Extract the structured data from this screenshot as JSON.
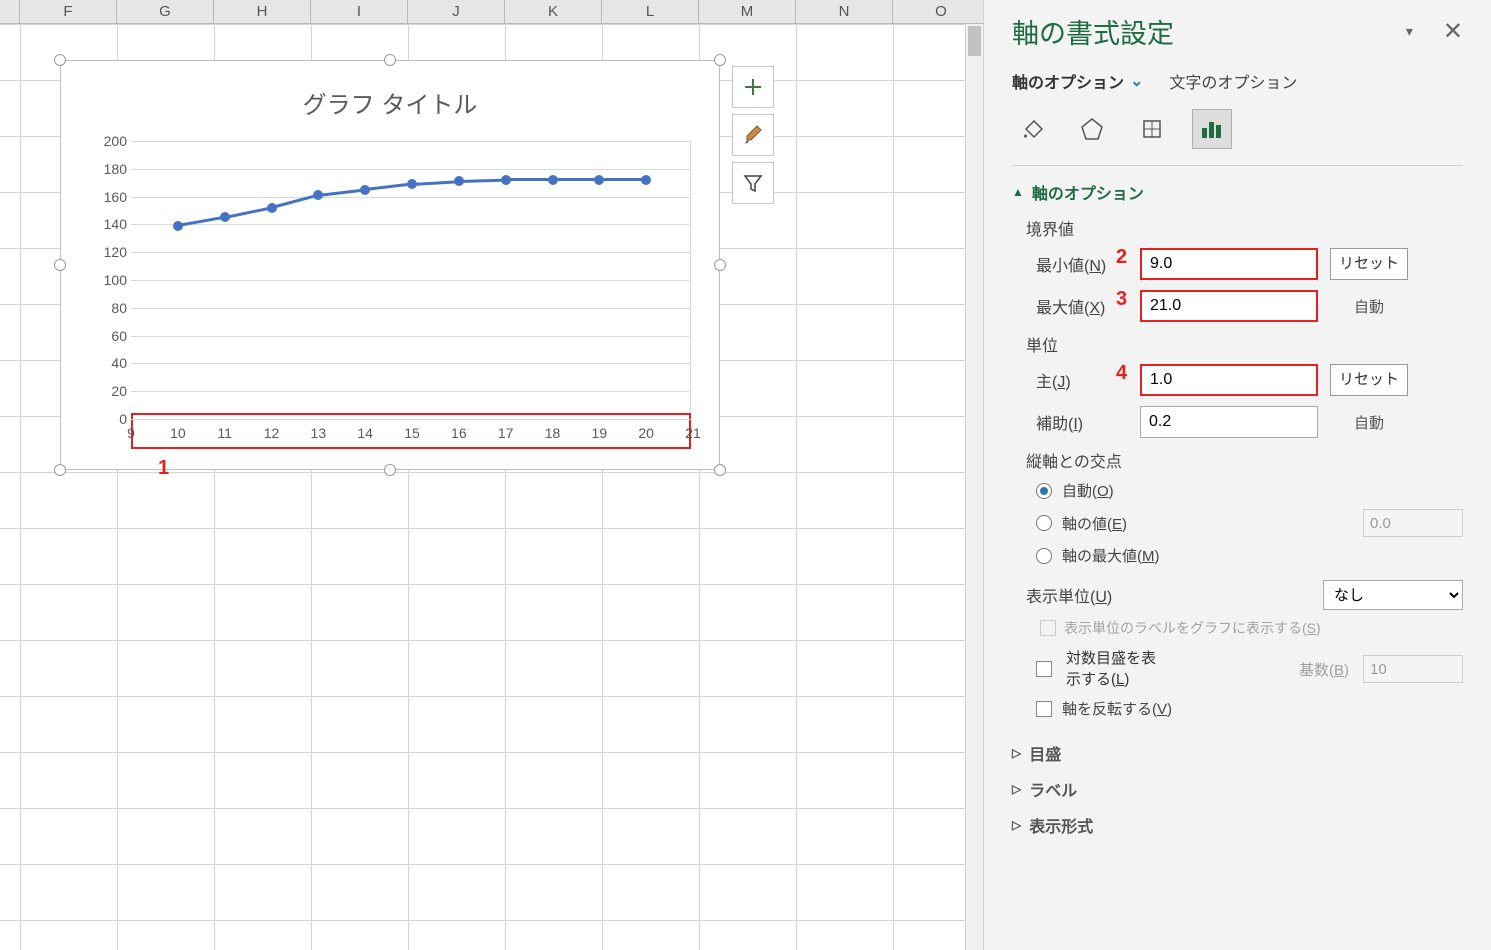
{
  "columns": [
    "F",
    "G",
    "H",
    "I",
    "J",
    "K",
    "L",
    "M",
    "N",
    "O"
  ],
  "chart": {
    "title": "グラフ タイトル",
    "y_ticks": [
      "200",
      "180",
      "160",
      "140",
      "120",
      "100",
      "80",
      "60",
      "40",
      "20",
      "0"
    ],
    "x_ticks": [
      "9",
      "10",
      "11",
      "12",
      "13",
      "14",
      "15",
      "16",
      "17",
      "18",
      "19",
      "20",
      "21"
    ]
  },
  "chart_data": {
    "type": "line",
    "title": "グラフ タイトル",
    "xlabel": "",
    "ylabel": "",
    "xlim": [
      9,
      21
    ],
    "ylim": [
      0,
      200
    ],
    "x_major_unit": 1.0,
    "x_minor_unit": 0.2,
    "series": [
      {
        "name": "",
        "x": [
          10,
          11,
          12,
          13,
          14,
          15,
          16,
          17,
          18,
          19,
          20
        ],
        "values": [
          139,
          145,
          152,
          161,
          165,
          169,
          171,
          172,
          172,
          172,
          172
        ]
      }
    ]
  },
  "annotations": {
    "a1": "1",
    "a2": "2",
    "a3": "3",
    "a4": "4"
  },
  "panel": {
    "title": "軸の書式設定",
    "tab_axis": "軸のオプション",
    "tab_text": "文字のオプション",
    "section_axis_options": "軸のオプション",
    "bounds": {
      "label": "境界値",
      "min_label": "最小値(N)",
      "min_value": "9.0",
      "min_action": "リセット",
      "max_label": "最大値(X)",
      "max_value": "21.0",
      "max_action": "自動"
    },
    "units": {
      "label": "単位",
      "major_label": "主(J)",
      "major_value": "1.0",
      "major_action": "リセット",
      "minor_label": "補助(I)",
      "minor_value": "0.2",
      "minor_action": "自動"
    },
    "cross": {
      "label": "縦軸との交点",
      "auto": "自動(O)",
      "value": "軸の値(E)",
      "value_input": "0.0",
      "max": "軸の最大値(M)"
    },
    "display_units": {
      "label": "表示単位(U)",
      "value": "なし",
      "show_label_on_chart": "表示単位のラベルをグラフに表示する(S)"
    },
    "log_scale": {
      "label": "対数目盛を表示する(L)",
      "base_label": "基数(B)",
      "base_value": "10"
    },
    "reverse": {
      "label": "軸を反転する(V)"
    },
    "section_ticks": "目盛",
    "section_labels": "ラベル",
    "section_number": "表示形式"
  }
}
